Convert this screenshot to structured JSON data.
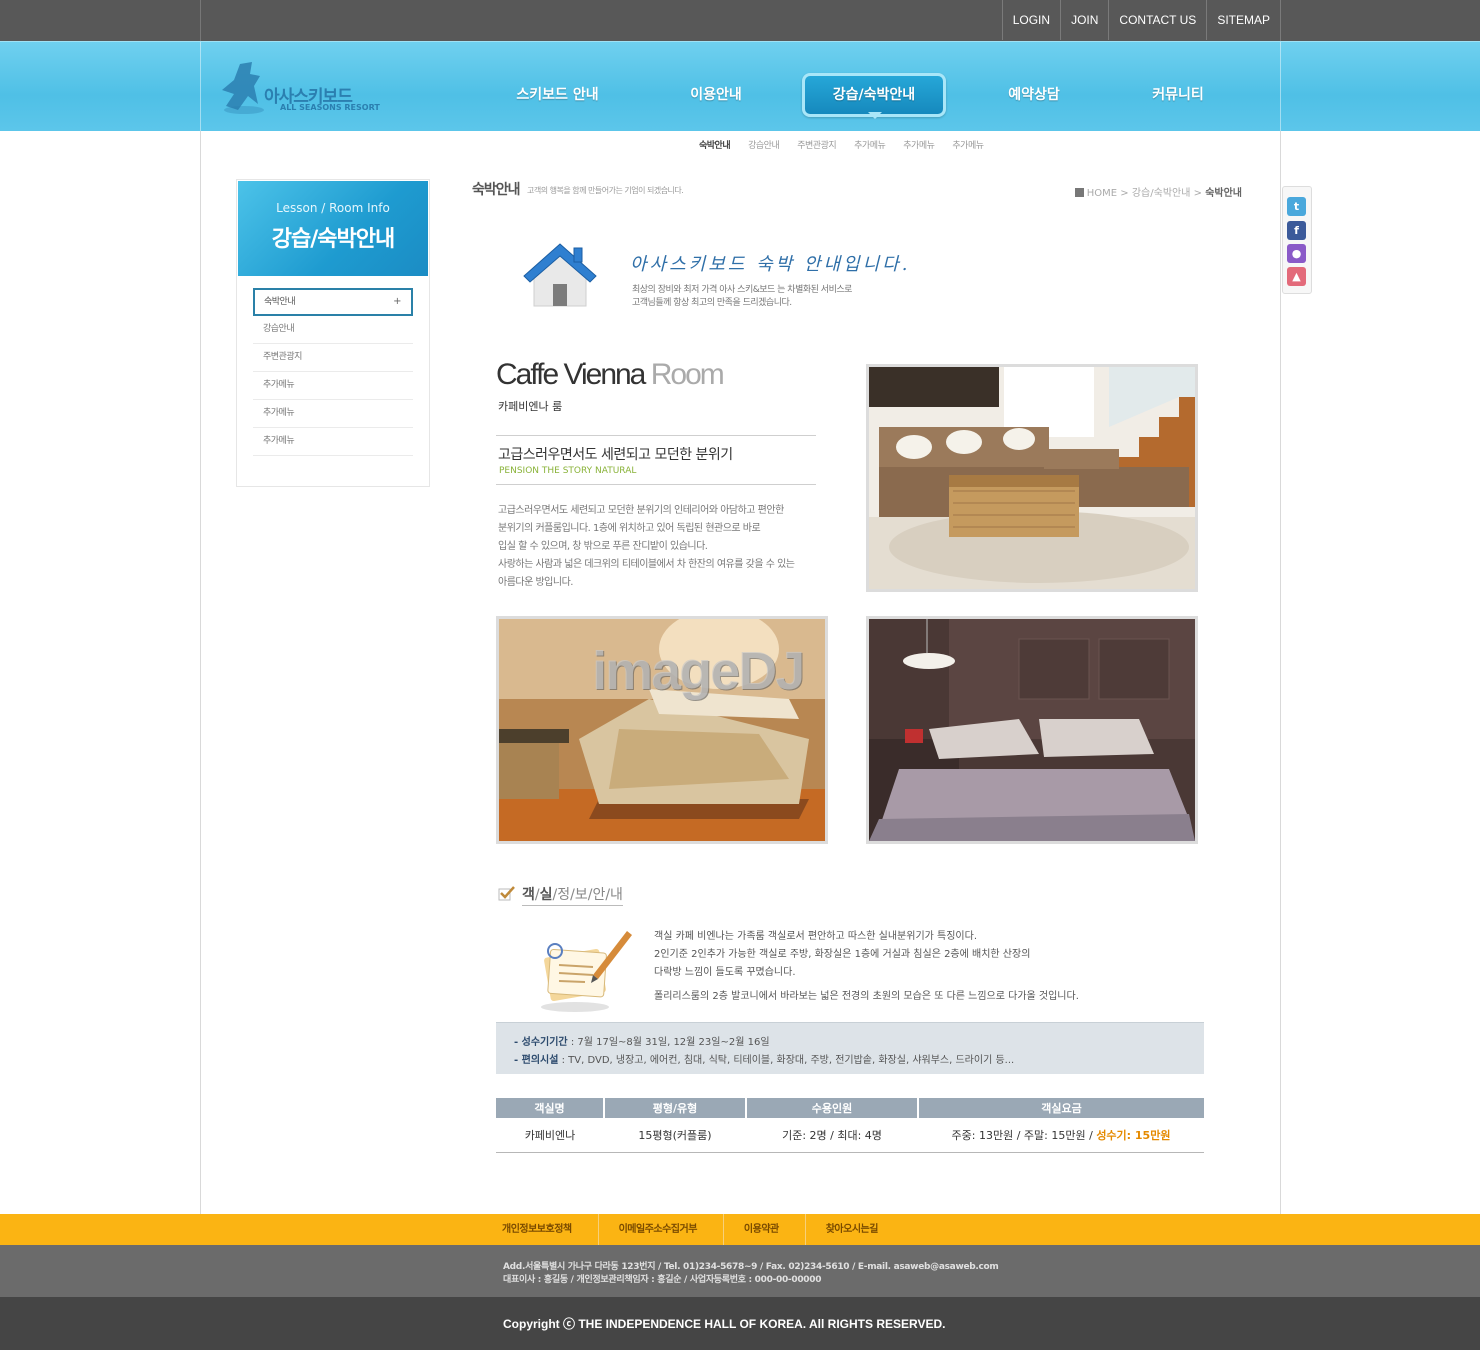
{
  "top_links": [
    "LOGIN",
    "JOIN",
    "CONTACT US",
    "SITEMAP"
  ],
  "logo": {
    "title": "아사스키보드",
    "sub": "ALL SEASONS RESORT"
  },
  "gnb": [
    "스키보드 안내",
    "이용안내",
    "강습/숙박안내",
    "예약상담",
    "커뮤니티"
  ],
  "subnav": [
    "숙박안내",
    "강습안내",
    "주변관광지",
    "추가메뉴",
    "추가메뉴",
    "추가메뉴"
  ],
  "sidebar": {
    "title_en": "Lesson / Room Info",
    "title_ko": "강습/숙박안내",
    "items": [
      "숙박안내",
      "강습안내",
      "주변관광지",
      "추가메뉴",
      "추가메뉴",
      "추가메뉴"
    ],
    "active_marker": "+"
  },
  "content": {
    "title": "숙박안내",
    "desc": "고객의 행복을 함께 만들어가는 기업이 되겠습니다.",
    "breadcrumb": {
      "home": "HOME",
      "sep": ">",
      "parent": "강습/숙박안내",
      "current": "숙박안내"
    }
  },
  "intro": {
    "title": "아사스키보드 숙박 안내입니다.",
    "line1": "최상의 장비와 최저 가격 아사 스키&보드 는 차별화된 서비스로",
    "line2": "고객님들께 항상 최고의 만족을 드리겠습니다."
  },
  "room": {
    "name_en_dark": "Caffe Vienna",
    "name_en_light": "Room",
    "name_ko": "카페비엔나 룸",
    "tagline": "고급스러우면서도 세련되고 모던한 분위기",
    "tagline_sub": "PENSION  THE STORY NATURAL",
    "body": [
      "고급스러우면서도 세련되고 모던한 분위기의 인테리어와 아담하고 편안한",
      "분위기의 커플룸입니다. 1층에 위치하고 있어 독립된 현관으로 바로",
      "입실 할 수 있으며, 창 밖으로 푸른 잔디밭이 있습니다.",
      "사랑하는 사람과 넓은 데크위의 티테이블에서 차 한잔의 여유를 갖을 수 있는",
      "아름다운 방입니다."
    ]
  },
  "watermark": "imageDJ",
  "room_info": {
    "title_parts": [
      "객",
      "/",
      "실",
      "/",
      "정",
      "/",
      "보",
      "/",
      "안",
      "/",
      "내"
    ],
    "lines": [
      "객실 카페 비엔나는 가족룸 객실로서 편안하고 따스한 실내분위기가 특징이다.",
      "2인기준 2인추가 가능한 객실로 주방, 화장실은 1층에 거실과 침실은 2층에 배치한 산장의",
      "다락방 느낌이 들도록 꾸몄습니다."
    ],
    "line_last": "폴리리스룸의 2층 발코니에서 바라보는 넓은 전경의 초원의 모습은 또 다른 느낌으로 다가올 것입니다.",
    "peak_label": "- 성수기기간",
    "peak_value": ": 7월 17일~8월 31일, 12월 23일~2월 16일",
    "facility_label": "- 편의시설",
    "facility_value": ": TV, DVD, 냉장고, 에어컨, 침대, 식탁, 티테이블, 화장대, 주방,  전기밥솥, 화장실, 샤워부스, 드라이기 등..."
  },
  "table": {
    "headers": [
      "객실명",
      "평형/유형",
      "수용인원",
      "객실요금"
    ],
    "row": {
      "name": "카페비엔나",
      "type": "15평형(커플룸)",
      "capacity": "기준: 2명 / 최대: 4명",
      "price": "주중: 13만원 / 주말: 15만원 /",
      "price_peak": "성수기: 15만원"
    }
  },
  "sns": [
    "twitter-icon",
    "facebook-icon",
    "me2day-icon",
    "blog-icon"
  ],
  "footer": {
    "links": [
      "개인정보보호정책",
      "이메일주소수집거부",
      "이용약관",
      "찾아오시는길"
    ],
    "address": "Add.서울특별시 가나구 다라동 123번지  / Tel. 01)234-5678~9  / Fax. 02)234-5610  / E-mail. asaweb@asaweb.com",
    "owner": "대표이사 : 홍길동 / 개인정보관리책임자 : 홍길순 / 사업자등록번호 : 000-00-00000",
    "copyright": "Copyright ⓒ THE INDEPENDENCE HALL OF KOREA. All RIGHTS RESERVED."
  },
  "colors": {
    "header": "#4fc0e6",
    "accent": "#1689bd",
    "footer_nav": "#fbb413",
    "peak": "#e58a00"
  }
}
